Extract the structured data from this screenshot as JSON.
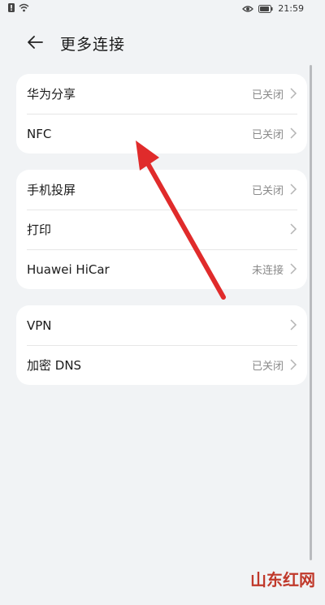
{
  "status_bar": {
    "time": "21:59",
    "icons": [
      "alert-icon",
      "wifi-icon",
      "eye-icon",
      "battery-icon"
    ]
  },
  "header": {
    "title": "更多连接",
    "back_icon": "back-arrow-icon"
  },
  "sections": [
    {
      "items": [
        {
          "label": "华为分享",
          "value": "已关闭"
        },
        {
          "label": "NFC",
          "value": "已关闭"
        }
      ]
    },
    {
      "items": [
        {
          "label": "手机投屏",
          "value": "已关闭"
        },
        {
          "label": "打印",
          "value": ""
        },
        {
          "label": "Huawei HiCar",
          "value": "未连接"
        }
      ]
    },
    {
      "items": [
        {
          "label": "VPN",
          "value": ""
        },
        {
          "label": "加密 DNS",
          "value": "已关闭"
        }
      ]
    }
  ],
  "annotation": {
    "arrow_color": "#e02b2b"
  },
  "watermark": {
    "text": "山东红网"
  }
}
